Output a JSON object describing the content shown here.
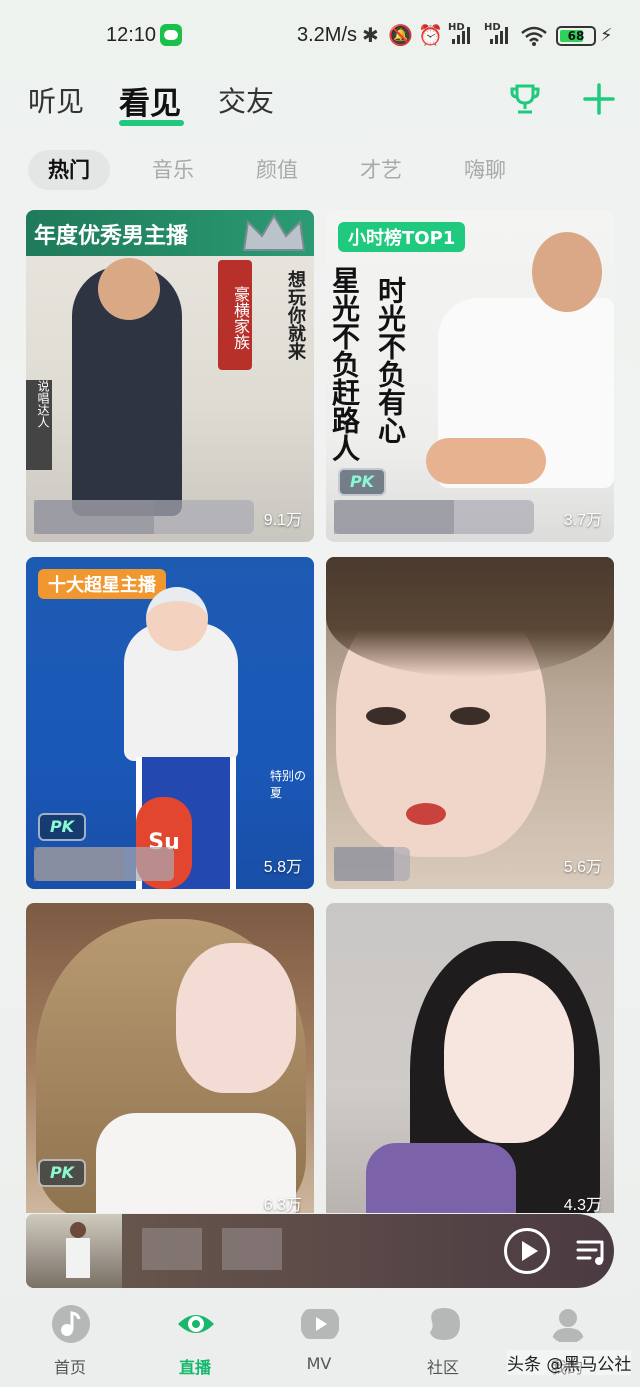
{
  "status_bar": {
    "time": "12:10",
    "net_speed": "3.2M/s",
    "battery": "68"
  },
  "top_tabs": [
    "听见",
    "看见",
    "交友"
  ],
  "categories": [
    "热门",
    "音乐",
    "颜值",
    "才艺",
    "嗨聊"
  ],
  "cards": [
    {
      "tag": "年度优秀男主播",
      "views": "9.1万",
      "side_text": [
        "豪横家族",
        "想玩你就来",
        "说唱达人"
      ]
    },
    {
      "tag": "小时榜TOP1",
      "views": "3.7万",
      "pk": "PK",
      "poem_left": "星光不负赶路人",
      "poem_right": "时光不负有心"
    },
    {
      "tag": "十大超星主播",
      "views": "5.8万",
      "pk": "PK",
      "overlay_text": "特别の夏",
      "board_text": "Su"
    },
    {
      "views": "5.6万"
    },
    {
      "views": "6.3万",
      "pk": "PK"
    },
    {
      "views": "4.3万"
    }
  ],
  "bottom_nav": [
    "首页",
    "直播",
    "MV",
    "社区",
    "我的"
  ],
  "watermark": "头条 @黑马公社",
  "colors": {
    "accent": "#1fca7e",
    "active_nav": "#17b86e"
  }
}
